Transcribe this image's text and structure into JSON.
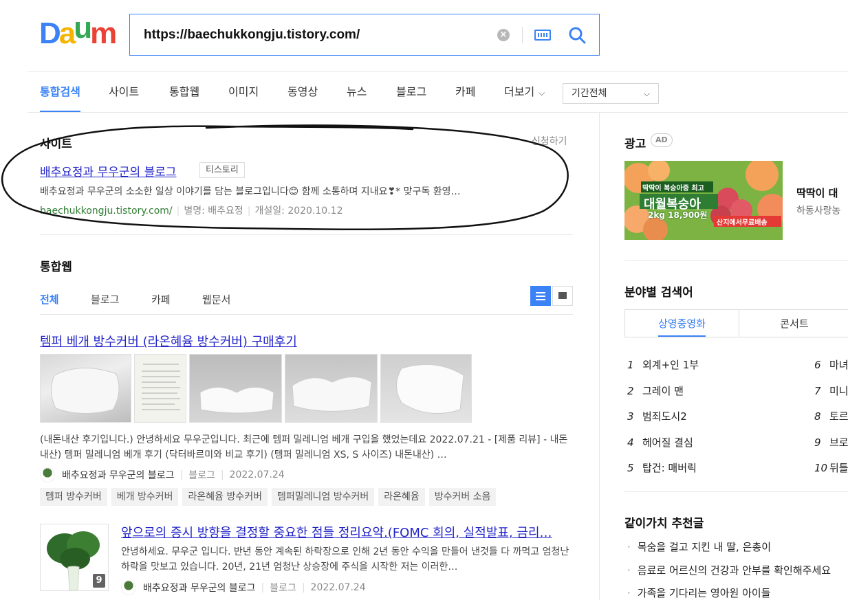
{
  "brand": {
    "logo_letters": [
      "D",
      "a",
      "u",
      "m"
    ],
    "colors": [
      "#3b82f6",
      "#f4b400",
      "#34a853",
      "#ea4335"
    ]
  },
  "search": {
    "query": "https://baechukkongju.tistory.com/",
    "clear_symbol": "×"
  },
  "nav": {
    "tabs": [
      "통합검색",
      "사이트",
      "통합웹",
      "이미지",
      "동영상",
      "뉴스",
      "블로그",
      "카페",
      "더보기"
    ],
    "more_chevron": "⌵",
    "period": "기간전체"
  },
  "site_section": {
    "title": "사이트",
    "apply_link": "신청하기",
    "result": {
      "title": "배추요정과 무우군의 블로그",
      "tag": "티스토리",
      "description": "배추요정과 무우군의 소소한 일상 이야기를 담는 블로그입니다😊 함께 소통하며 지내요❣* 맞구독 환영…",
      "url": "baechukkongju.tistory.com/",
      "alias": "별명: 배추요정",
      "opened": "개설일: 2020.10.12"
    }
  },
  "web_section": {
    "title": "통합웹",
    "subtabs": [
      "전체",
      "블로그",
      "카페",
      "웹문서"
    ],
    "posts": [
      {
        "title": "템퍼 베개 방수커버 (라온혜윰 방수커버) 구매후기",
        "description": "(내돈내산 후기입니다.) 안녕하세요 무우군입니다. 최근에 템퍼 밀레니엄 베개 구입을 했었는데요 2022.07.21 - [제품 리뷰] - 내돈내산) 템퍼 밀레니엄 베개 후기 (닥터바르미와 비교 후기) (템퍼 밀레니엄 XS, S 사이즈) 내돈내산) …",
        "author": "배추요정과 무우군의 블로그",
        "source": "블로그",
        "date": "2022.07.24",
        "tags": [
          "템퍼 방수커버",
          "베개 방수커버",
          "라온혜윰 방수커버",
          "템퍼밀레니엄 방수커버",
          "라온혜윰",
          "방수커버 소음"
        ]
      },
      {
        "title": "앞으로의 증시 방향을 결정할 중요한 점들 정리요약.(FOMC 회의, 실적발표, 금리…",
        "description": "안녕하세요. 무우군 입니다. 반년 동안 계속된 하락장으로 인해 2년 동안 수익을 만들어 낸것들 다 까먹고 엄청난 하락을 맛보고 있습니다. 20년, 21년 엄청난 상승장에 주식을 시작한 저는 이러한…",
        "author": "배추요정과 무우군의 블로그",
        "source": "블로그",
        "date": "2022.07.24",
        "image_count": "9"
      }
    ]
  },
  "sidebar": {
    "ad": {
      "label": "광고",
      "badge": "AD",
      "banner_top": "딱딱이 복숭아중 최고",
      "banner_main": "대월복숭아",
      "banner_price": "2kg 18,900원",
      "banner_shipping": "산지에서무료배송",
      "title": "딱딱이 대",
      "subtitle": "하동사랑농"
    },
    "category_search": {
      "title": "분야별 검색어",
      "tabs": [
        "상영중영화",
        "콘서트"
      ],
      "left": [
        {
          "rank": "1",
          "name": "외계+인 1부"
        },
        {
          "rank": "2",
          "name": "그레이 맨"
        },
        {
          "rank": "3",
          "name": "범죄도시2"
        },
        {
          "rank": "4",
          "name": "헤어질 결심"
        },
        {
          "rank": "5",
          "name": "탑건: 매버릭"
        }
      ],
      "right": [
        {
          "rank": "6",
          "name": "마녀"
        },
        {
          "rank": "7",
          "name": "미니"
        },
        {
          "rank": "8",
          "name": "토르"
        },
        {
          "rank": "9",
          "name": "브로"
        },
        {
          "rank": "10",
          "name": "뒤틀"
        }
      ]
    },
    "recommend": {
      "title": "같이가치 추천글",
      "items": [
        "목숨을 걸고 지킨 내 딸, 은총이",
        "음료로 어르신의 건강과 안부를 확인해주세요",
        "가족을 기다리는 영아원 아이들"
      ]
    }
  }
}
